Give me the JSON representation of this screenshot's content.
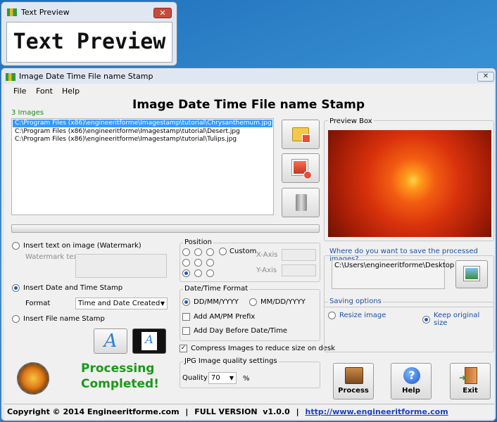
{
  "preview_window": {
    "title": "Text Preview",
    "close": "✕",
    "preview_text": "Text Preview"
  },
  "main_window": {
    "title": "Image Date Time File name Stamp",
    "close": "✕"
  },
  "menu": [
    "File",
    "Font",
    "Help"
  ],
  "heading": "Image Date Time File name Stamp",
  "image_count": "3 Images",
  "files": [
    "C:\\Program Files (x86)\\engineeritforme\\Imagestamp\\tutorial\\Chrysanthemum.jpg",
    "C:\\Program Files (x86)\\engineeritforme\\Imagestamp\\tutorial\\Desert.jpg",
    "C:\\Program Files (x86)\\engineeritforme\\Imagestamp\\tutorial\\Tulips.jpg"
  ],
  "preview_box_label": "Preview Box",
  "watermark_option": "Insert text on image (Watermark)",
  "watermark_text_label": "Watermark text",
  "datetime_option": "Insert Date and Time Stamp",
  "format_label": "Format",
  "format_value": "Time and Date Created",
  "filename_option": "Insert File name Stamp",
  "position": {
    "label": "Position",
    "custom": "Custom",
    "x_axis": "X-Axis",
    "y_axis": "Y-Axis"
  },
  "datetime_format": {
    "label": "Date/Time Format",
    "opt1": "DD/MM/YYYY",
    "opt2": "MM/DD/YYYY",
    "ampm": "Add AM/PM Prefix",
    "addday": "Add Day Before Date/Time"
  },
  "compress": "Compress Images to reduce size on desk",
  "jpg_quality": {
    "label": "JPG Image quality settings",
    "quality_label": "Quality",
    "value": "70",
    "percent": "%"
  },
  "save": {
    "question": "Where do you want to save the processed images?",
    "path": "C:\\Users\\engineeritforme\\Desktop"
  },
  "saving_options": {
    "label": "Saving options",
    "resize": "Resize image",
    "keep": "Keep original size"
  },
  "status": {
    "line1": "Processing",
    "line2": "Completed!"
  },
  "buttons": {
    "process": "Process",
    "help": "Help",
    "exit": "Exit"
  },
  "footer": {
    "copyright": "Copyright © 2014 Engineeritforme.com",
    "sep1": "|",
    "version": "FULL VERSION  v1.0.0",
    "sep2": "|",
    "url": "http://www.engineeritforme.com"
  }
}
